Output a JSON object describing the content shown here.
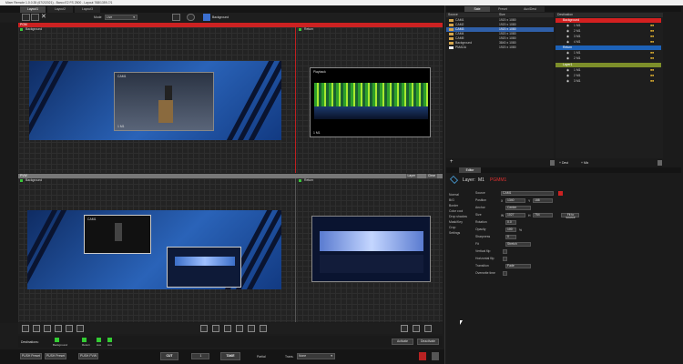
{
  "window_title": "Mixer Remote 1.0.0.35 (67/2/2021) - Barco E2 FS 2500 - Layout 768/1359-7/1",
  "tabs": [
    "Layout1",
    "Layout2",
    "Layout3"
  ],
  "toolbar": {
    "mode_label": "Mode",
    "mode_value": "Live",
    "background_label": "Background"
  },
  "pgm": {
    "label": "PGM",
    "screen_left": "Background",
    "screen_right": "Return"
  },
  "pvw": {
    "label": "PVW",
    "screen_left": "Background",
    "screen_right": "Return",
    "btn1": "Layer",
    "btn2": "Clear"
  },
  "cams": {
    "cam1": "CAM1",
    "playback": "Playback",
    "m1": "1 M1"
  },
  "right_tabs": [
    "Sate",
    "Preset",
    "Aux/Dest"
  ],
  "sources": {
    "col_name": "Source",
    "col_size": "Size",
    "items": [
      {
        "name": "CAM1",
        "size": "1920 x 1080"
      },
      {
        "name": "CAM2",
        "size": "1920 x 1080"
      },
      {
        "name": "CAM3",
        "size": "1920 x 1080"
      },
      {
        "name": "CAM4",
        "size": "1920 x 1080"
      },
      {
        "name": "CAM5",
        "size": "1920 x 1080"
      },
      {
        "name": "Background",
        "size": "3840 x 1080"
      },
      {
        "name": "PMADA",
        "size": "1920 x 1080"
      }
    ]
  },
  "destinations": {
    "header": "Destination",
    "groups": [
      {
        "name": "Background",
        "color": "#d42020",
        "items": [
          "1 M1",
          "2 M1",
          "3 M1",
          "4 M1"
        ]
      },
      {
        "name": "Return",
        "color": "#1d62b8",
        "items": [
          "1 M1",
          "2 M1"
        ]
      },
      {
        "name": "Layer1",
        "color": "#7d8f2a",
        "items": [
          "1 M1",
          "2 M1",
          "3 M1"
        ]
      }
    ]
  },
  "source_footer": {
    "dest": "Dest",
    "mix": "Mix"
  },
  "editor": {
    "tab": "Editor",
    "layer_label": "Layer:",
    "layer_value": "M1",
    "layer_name": "PGMM1",
    "categories": [
      "Normal",
      "B/G",
      "Border",
      "Color cool",
      "Drop shadow",
      "Mask/Key",
      "Crop",
      "Settings"
    ],
    "props": [
      {
        "label": "Source",
        "value": "CAM1"
      },
      {
        "label": "Position",
        "x": "1340",
        "y": "188"
      },
      {
        "label": "Anchor",
        "value": "Center"
      },
      {
        "label": "Size",
        "w": "1027",
        "h": "754",
        "btn": "Fit to source"
      },
      {
        "label": "Rotation",
        "value": "0.0"
      },
      {
        "label": "Opacity",
        "value": "100"
      },
      {
        "label": "Sharpness",
        "value": "0"
      },
      {
        "label": "Fit",
        "value": "Stretch"
      },
      {
        "label": "Vertical flip"
      },
      {
        "label": "Horizontal flip"
      },
      {
        "label": "Transition",
        "value": "Fade"
      },
      {
        "label": "Overwrite time"
      }
    ]
  },
  "destinations_bar": {
    "label": "Destinations:",
    "items": [
      "Background",
      "Return",
      "Aux",
      "Aux"
    ],
    "activate": "Activate",
    "deactivate": "Deactivate"
  },
  "bottom": {
    "push_preset": "PUSH Preset",
    "push_preset2": "PUSH Preset",
    "push_pvw": "PUSH PVW",
    "cut": "CUT",
    "frames": "1",
    "take": "TAKE",
    "partial": "Partial",
    "trans_label": "Trans.",
    "trans_value": "None"
  }
}
